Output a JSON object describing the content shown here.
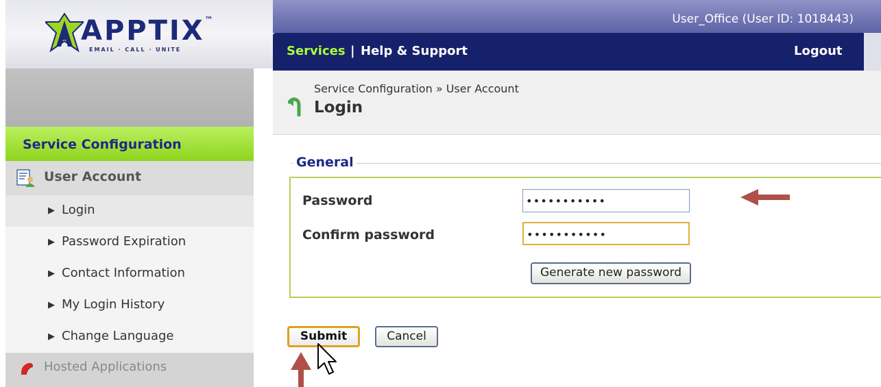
{
  "app": {
    "logo_text": "APPTIX",
    "logo_tagline": "EMAIL · CALL · UNITE",
    "logo_trademark": "™"
  },
  "header": {
    "user_label": "User_Office (User ID: 1018443)"
  },
  "nav": {
    "services": "Services",
    "separator": "|",
    "help_support": "Help & Support",
    "logout": "Logout"
  },
  "sidebar": {
    "section_label": "Service Configuration",
    "group_label": "User Account",
    "group_icon": "user-account-icon",
    "items": [
      {
        "label": "Login"
      },
      {
        "label": "Password Expiration"
      },
      {
        "label": "Contact Information"
      },
      {
        "label": "My Login History"
      },
      {
        "label": "Change Language"
      }
    ],
    "hosted_label": "Hosted Applications",
    "hosted_icon": "hosted-applications-icon",
    "arrow_glyph": "▶"
  },
  "main": {
    "breadcrumb": "Service Configuration » User Account",
    "title": "Login",
    "fieldset_legend": "General",
    "password_label": "Password",
    "password_value": "•••••••••••",
    "confirm_label": "Confirm password",
    "confirm_value": "•••••••••••",
    "generate_button": "Generate new password",
    "submit_button": "Submit",
    "cancel_button": "Cancel"
  },
  "colors": {
    "nav_bg": "#16216b",
    "nav_accent": "#a8ff3c",
    "section_green": "#8fd41e",
    "annotation_arrow": "#b0504a"
  }
}
